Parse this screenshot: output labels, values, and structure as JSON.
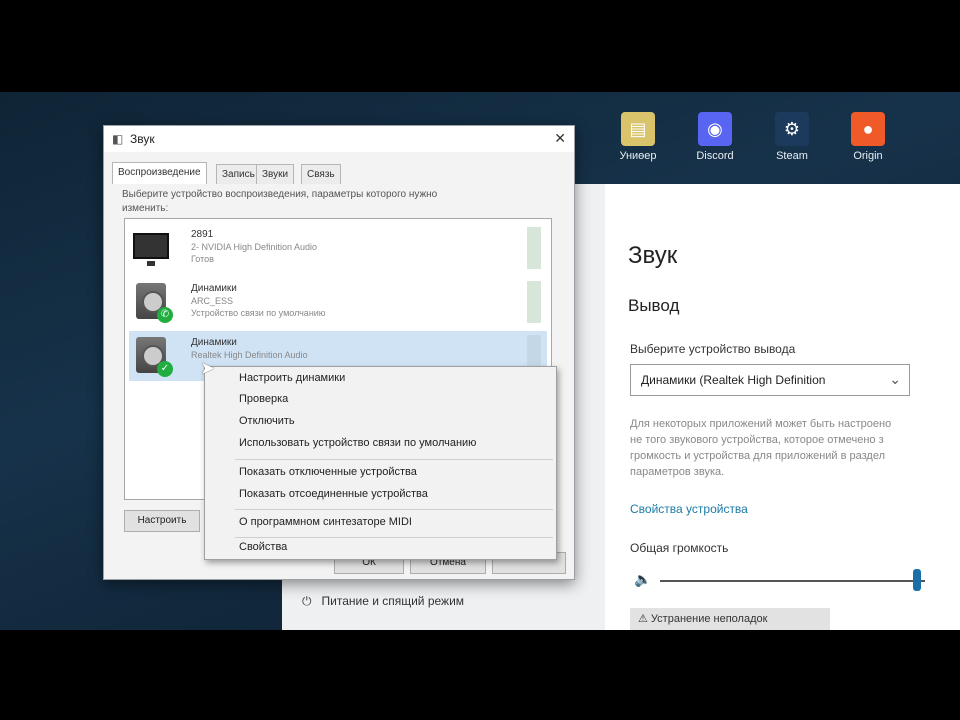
{
  "desktop": {
    "icons": [
      {
        "label": "Униөер",
        "icon": "folder-icon",
        "color": "#d9c36b"
      },
      {
        "label": "Discord",
        "icon": "discord-icon",
        "color": "#5865f2"
      },
      {
        "label": "Steam",
        "icon": "steam-icon",
        "color": "#1b3a5c"
      },
      {
        "label": "Origin",
        "icon": "origin-icon",
        "color": "#f05a28"
      }
    ]
  },
  "sound_dialog": {
    "title": "Звук",
    "close_glyph": "✕",
    "tabs": [
      "Воспроизведение",
      "Запись",
      "Звуки",
      "Связь"
    ],
    "intro": "Выберите устройство воспроизведения, параметры которого нужно\nизменить:",
    "devices": [
      {
        "name": "2891",
        "description": "2- NVIDIA High Definition Audio",
        "status": "Готов",
        "type": "monitor",
        "default": false,
        "selected": false
      },
      {
        "name": "Динамики",
        "description": "ARC_ESS",
        "status": "Устройство связи по умолчанию",
        "type": "speaker",
        "default": true,
        "selected": false
      },
      {
        "name": "Динамики",
        "description": "Realtek High Definition Audio",
        "status": "",
        "type": "speaker",
        "default": true,
        "selected": true
      }
    ],
    "configure_button": "Настроить",
    "ok_button": "ОК",
    "cancel_button": "Отмена",
    "apply_button": ""
  },
  "context_menu": {
    "items": [
      "Настроить динамики",
      "Проверка",
      "Отключить",
      "Использовать устройство связи по умолчанию",
      "Показать отключенные устройства",
      "Показать отсоединенные устройства",
      "О программном синтезаторе MIDI",
      "Свойства"
    ]
  },
  "settings": {
    "title": "Звук",
    "section": "Вывод",
    "output_label": "Выберите устройство вывода",
    "output_value": "Динамики (Realtek High Definition",
    "description": "Для некоторых приложений может быть настроено\nне того звукового устройства, которое отмечено з\nгромкость и устройства для приложений в раздел\nпараметров звука.",
    "device_props_link": "Свойства устройства",
    "volume_label": "Общая громкость",
    "volume_level": 0.97,
    "troubleshoot_button": "Устранение неполадок",
    "power_label": "Питание и спящий режим"
  }
}
